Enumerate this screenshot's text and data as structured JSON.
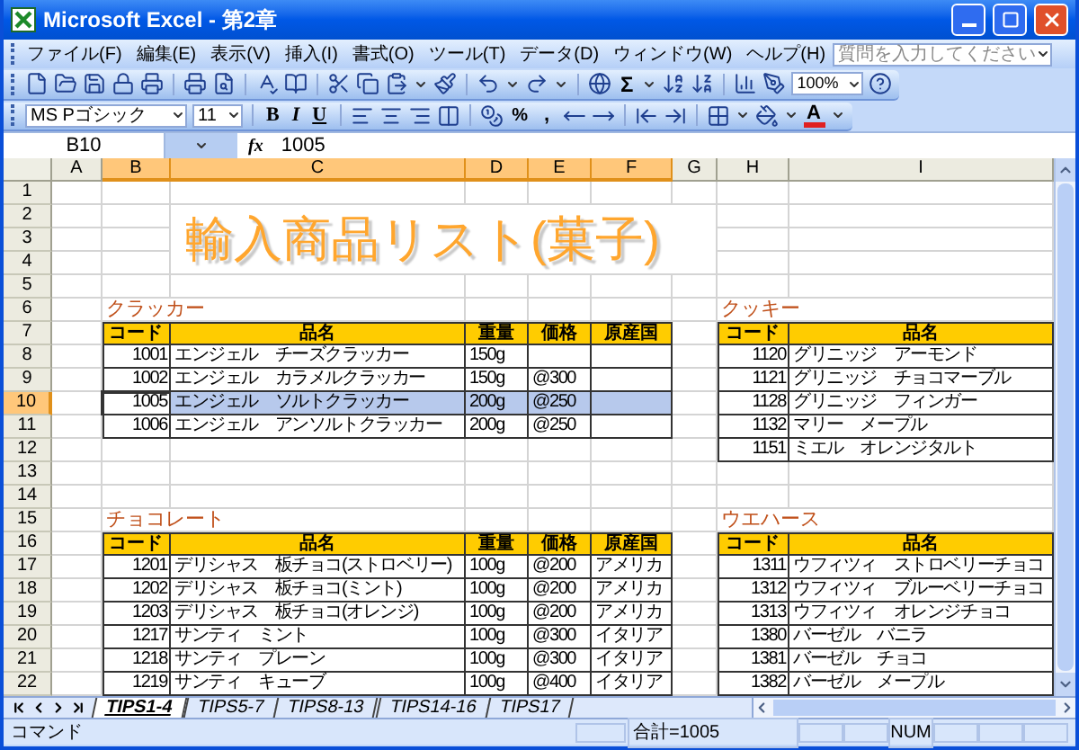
{
  "window": {
    "title": "Microsoft Excel - 第2章"
  },
  "menu": [
    "ファイル(F)",
    "編集(E)",
    "表示(V)",
    "挿入(I)",
    "書式(O)",
    "ツール(T)",
    "データ(D)",
    "ウィンドウ(W)",
    "ヘルプ(H)"
  ],
  "help_search": {
    "placeholder": "質問を入力してください"
  },
  "standard_toolbar": {
    "sum": "Σ",
    "zoom": "100%"
  },
  "format_toolbar": {
    "font": "MS Pゴシック",
    "size": "11",
    "bold": "B",
    "italic": "I",
    "underline": "U",
    "percent": "%",
    "comma": ",",
    "font_color": "A"
  },
  "formula_bar": {
    "name_box": "B10",
    "fx": "fx",
    "value": "1005"
  },
  "sheet": {
    "columns": [
      {
        "label": "A",
        "selected": false
      },
      {
        "label": "B",
        "selected": true
      },
      {
        "label": "C",
        "selected": true
      },
      {
        "label": "D",
        "selected": true
      },
      {
        "label": "E",
        "selected": true
      },
      {
        "label": "F",
        "selected": true
      },
      {
        "label": "G",
        "selected": false
      },
      {
        "label": "H",
        "selected": false
      },
      {
        "label": "I",
        "selected": false
      }
    ],
    "rows": [
      {
        "label": "1",
        "selected": false
      },
      {
        "label": "2",
        "selected": false
      },
      {
        "label": "3",
        "selected": false
      },
      {
        "label": "4",
        "selected": false
      },
      {
        "label": "5",
        "selected": false
      },
      {
        "label": "6",
        "selected": false
      },
      {
        "label": "7",
        "selected": false
      },
      {
        "label": "8",
        "selected": false
      },
      {
        "label": "9",
        "selected": false
      },
      {
        "label": "10",
        "selected": true
      },
      {
        "label": "11",
        "selected": false
      },
      {
        "label": "12",
        "selected": false
      },
      {
        "label": "13",
        "selected": false
      },
      {
        "label": "14",
        "selected": false
      },
      {
        "label": "15",
        "selected": false
      },
      {
        "label": "16",
        "selected": false
      },
      {
        "label": "17",
        "selected": false
      },
      {
        "label": "18",
        "selected": false
      },
      {
        "label": "19",
        "selected": false
      },
      {
        "label": "20",
        "selected": false
      },
      {
        "label": "21",
        "selected": false
      },
      {
        "label": "22",
        "selected": false
      }
    ],
    "title": "輸入商品リスト(菓子)",
    "tables": [
      {
        "title": "クラッカー",
        "headers": [
          "コード",
          "品名",
          "重量",
          "価格",
          "原産国"
        ],
        "rows": [
          {
            "code": "1001",
            "name": "エンジェル　チーズクラッカー",
            "weight": "150g",
            "selected": false
          },
          {
            "code": "1002",
            "name": "エンジェル　カラメルクラッカー",
            "weight": "150g",
            "price": "@300",
            "selected": false
          },
          {
            "code": "1005",
            "name": "エンジェル　ソルトクラッカー",
            "weight": "200g",
            "price": "@250",
            "selected": true
          },
          {
            "code": "1006",
            "name": "エンジェル　アンソルトクラッカー",
            "weight": "200g",
            "price": "@250",
            "selected": false
          }
        ]
      },
      {
        "title": "クッキー",
        "headers": [
          "コード",
          "品名"
        ],
        "rows": [
          {
            "code": "1120",
            "name": "グリニッジ　アーモンド",
            "selected": false
          },
          {
            "code": "1121",
            "name": "グリニッジ　チョコマーブル",
            "selected": false
          },
          {
            "code": "1128",
            "name": "グリニッジ　フィンガー",
            "selected": false
          },
          {
            "code": "1132",
            "name": "マリー　メープル",
            "selected": false
          },
          {
            "code": "1151",
            "name": "ミエル　オレンジタルト",
            "selected": false
          }
        ]
      },
      {
        "title": "チョコレート",
        "headers": [
          "コード",
          "品名",
          "重量",
          "価格",
          "原産国"
        ],
        "rows": [
          {
            "code": "1201",
            "name": "デリシャス　板チョコ(ストロベリー)",
            "weight": "100g",
            "price": "@200",
            "origin": "アメリカ",
            "selected": false
          },
          {
            "code": "1202",
            "name": "デリシャス　板チョコ(ミント)",
            "weight": "100g",
            "price": "@200",
            "origin": "アメリカ",
            "selected": false
          },
          {
            "code": "1203",
            "name": "デリシャス　板チョコ(オレンジ)",
            "weight": "100g",
            "price": "@200",
            "origin": "アメリカ",
            "selected": false
          },
          {
            "code": "1217",
            "name": "サンティ　ミント",
            "weight": "100g",
            "price": "@300",
            "origin": "イタリア",
            "selected": false
          },
          {
            "code": "1218",
            "name": "サンティ　プレーン",
            "weight": "100g",
            "price": "@300",
            "origin": "イタリア",
            "selected": false
          },
          {
            "code": "1219",
            "name": "サンティ　キューブ",
            "weight": "100g",
            "price": "@400",
            "origin": "イタリア",
            "selected": false
          }
        ]
      },
      {
        "title": "ウエハース",
        "headers": [
          "コード",
          "品名"
        ],
        "rows": [
          {
            "code": "1311",
            "name": "ウフィツィ　ストロベリーチョコ",
            "selected": false
          },
          {
            "code": "1312",
            "name": "ウフィツィ　ブルーベリーチョコ",
            "selected": false
          },
          {
            "code": "1313",
            "name": "ウフィツィ　オレンジチョコ",
            "selected": false
          },
          {
            "code": "1380",
            "name": "バーゼル　バニラ",
            "selected": false
          },
          {
            "code": "1381",
            "name": "バーゼル　チョコ",
            "selected": false
          },
          {
            "code": "1382",
            "name": "バーゼル　メープル",
            "selected": false
          }
        ]
      }
    ]
  },
  "sheet_tabs": [
    {
      "label": "TIPS1-4",
      "selected": true
    },
    {
      "label": "TIPS5-7",
      "selected": false
    },
    {
      "label": "TIPS8-13",
      "selected": false
    },
    {
      "label": "TIPS14-16",
      "selected": false
    },
    {
      "label": "TIPS17",
      "selected": false
    }
  ],
  "status_bar": {
    "mode": "コマンド",
    "sum": "合計=1005",
    "num": "NUM"
  }
}
